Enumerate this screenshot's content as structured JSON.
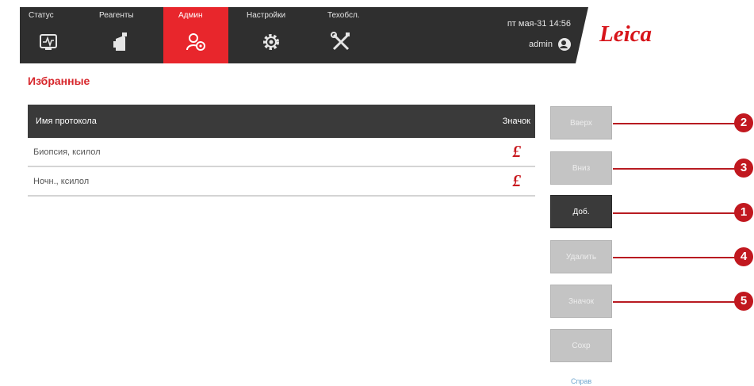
{
  "header": {
    "tabs": [
      {
        "label": "Статус",
        "icon": "status-monitor-icon"
      },
      {
        "label": "Реагенты",
        "icon": "reagent-bottle-icon"
      },
      {
        "label": "Админ",
        "icon": "admin-users-icon",
        "active": true
      },
      {
        "label": "Настройки",
        "icon": "gear-icon"
      },
      {
        "label": "Техобсл.",
        "icon": "tools-icon"
      }
    ],
    "datetime": "пт мая-31 14:56",
    "user": "admin",
    "logo": "Leica"
  },
  "page": {
    "title": "Избранные"
  },
  "table": {
    "columns": [
      "Имя протокола",
      "Значок"
    ],
    "rows": [
      {
        "name": "Биопсия, ксилол",
        "icon_glyph": "£",
        "icon": "leica-l-icon"
      },
      {
        "name": "Ночн., ксилол",
        "icon_glyph": "£",
        "icon": "leica-l-icon"
      }
    ]
  },
  "buttons": {
    "up": "Вверх",
    "down": "Вниз",
    "add": "Доб.",
    "delete": "Удалить",
    "icon": "Значок",
    "save": "Сохр",
    "help": "Справ"
  },
  "callouts": [
    "2",
    "3",
    "1",
    "4",
    "5"
  ],
  "colors": {
    "accent": "#e8262c",
    "header_bg": "#2f2f2f",
    "table_header_bg": "#3a3a3a",
    "disabled_button": "#c4c4c4",
    "callout": "#c1181f"
  }
}
